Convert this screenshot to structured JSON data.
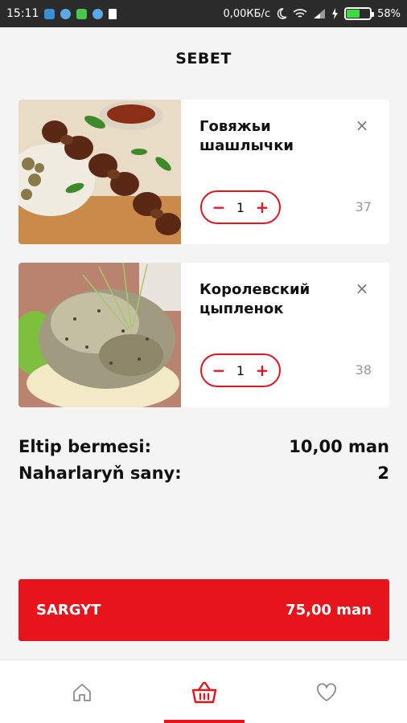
{
  "status_bar": {
    "time": "15:11",
    "network_speed": "0,00КБ/с",
    "battery": "58%",
    "battery_level": 0.58
  },
  "page": {
    "title": "SEBET"
  },
  "cart_items": [
    {
      "name": "Говяжьи шашлычки",
      "quantity": "1",
      "price": "37",
      "minus": "−",
      "plus": "+",
      "remove": "×"
    },
    {
      "name": "Королевский цыпленок",
      "quantity": "1",
      "price": "38",
      "minus": "−",
      "plus": "+",
      "remove": "×"
    }
  ],
  "summary": {
    "delivery_label": "Eltip bermesi:",
    "delivery_value": "10,00 man",
    "dishes_label": "Naharlaryň sany:",
    "dishes_value": "2"
  },
  "order_button": {
    "label": "SARGYT",
    "total": "75,00 man"
  },
  "bottom_nav": {
    "items": [
      {
        "icon": "home-icon",
        "active": false
      },
      {
        "icon": "basket-icon",
        "active": true
      },
      {
        "icon": "heart-icon",
        "active": false
      }
    ]
  },
  "colors": {
    "accent": "#e8141c",
    "background": "#f4f4f4",
    "card": "#ffffff",
    "muted": "#9a9a9a"
  }
}
